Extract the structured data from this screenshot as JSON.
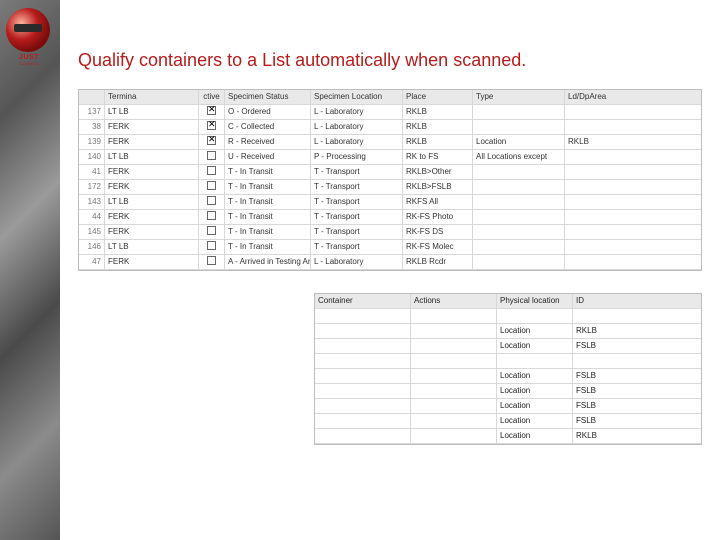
{
  "logo": {
    "line1": "JUST",
    "line2": "SCIENCE"
  },
  "title": "Qualify containers to a List automatically when scanned.",
  "ruleGrid": {
    "headers": {
      "id": "",
      "terminal": "Termina",
      "active": "ctive",
      "status": "Specimen Status",
      "location": "Specimen Location",
      "place": "Place",
      "type": "Type",
      "ld": "Ld/DpArea"
    },
    "rows": [
      {
        "id": "137",
        "term": "LT LB",
        "chk": true,
        "status": "O - Ordered",
        "loc": "L - Laboratory",
        "place": "RKLB",
        "type": "",
        "ld": ""
      },
      {
        "id": "38",
        "term": "FERK",
        "chk": true,
        "status": "C - Collected",
        "loc": "L - Laboratory",
        "place": "RKLB",
        "type": "",
        "ld": ""
      },
      {
        "id": "139",
        "term": "FERK",
        "chk": true,
        "status": "R - Received",
        "loc": "L - Laboratory",
        "place": "RKLB",
        "type": "Location",
        "ld": "RKLB"
      },
      {
        "id": "140",
        "term": "LT LB",
        "chk": false,
        "status": "U - Received",
        "loc": "P - Processing",
        "place": "RK to FS",
        "type": "All Locations except",
        "ld": ""
      },
      {
        "id": "41",
        "term": "FERK",
        "chk": false,
        "status": "T - In Transit",
        "loc": "T - Transport",
        "place": "RKLB>Other",
        "type": "",
        "ld": ""
      },
      {
        "id": "172",
        "term": "FERK",
        "chk": false,
        "status": "T - In Transit",
        "loc": "T - Transport",
        "place": "RKLB>FSLB",
        "type": "",
        "ld": ""
      },
      {
        "id": "143",
        "term": "LT LB",
        "chk": false,
        "status": "T - In Transit",
        "loc": "T - Transport",
        "place": "RKFS All",
        "type": "",
        "ld": ""
      },
      {
        "id": "44",
        "term": "FERK",
        "chk": false,
        "status": "T - In Transit",
        "loc": "T - Transport",
        "place": "RK-FS Photo",
        "type": "",
        "ld": ""
      },
      {
        "id": "145",
        "term": "FERK",
        "chk": false,
        "status": "T - In Transit",
        "loc": "T - Transport",
        "place": "RK-FS DS",
        "type": "",
        "ld": ""
      },
      {
        "id": "146",
        "term": "LT LB",
        "chk": false,
        "status": "T - In Transit",
        "loc": "T - Transport",
        "place": "RK-FS Molec",
        "type": "",
        "ld": ""
      },
      {
        "id": "47",
        "term": "FERK",
        "chk": false,
        "status": "A - Arrived in Testing Area",
        "loc": "L - Laboratory",
        "place": "RKLB Rcdr",
        "type": "",
        "ld": ""
      }
    ]
  },
  "contGrid": {
    "headers": {
      "container": "Container",
      "actions": "Actions",
      "phy": "Physical location",
      "id": "ID"
    },
    "rows": [
      {
        "cont": "",
        "act": "",
        "phy": "Location",
        "id": "RKLB"
      },
      {
        "cont": "",
        "act": "",
        "phy": "Location",
        "id": "FSLB"
      },
      {
        "cont": "",
        "act": "",
        "phy": "Location",
        "id": "FSLB"
      },
      {
        "cont": "",
        "act": "",
        "phy": "Location",
        "id": "FSLB"
      },
      {
        "cont": "",
        "act": "",
        "phy": "Location",
        "id": "FSLB"
      },
      {
        "cont": "",
        "act": "",
        "phy": "Location",
        "id": "FSLB"
      },
      {
        "cont": "",
        "act": "",
        "phy": "Location",
        "id": "RKLB"
      }
    ]
  }
}
